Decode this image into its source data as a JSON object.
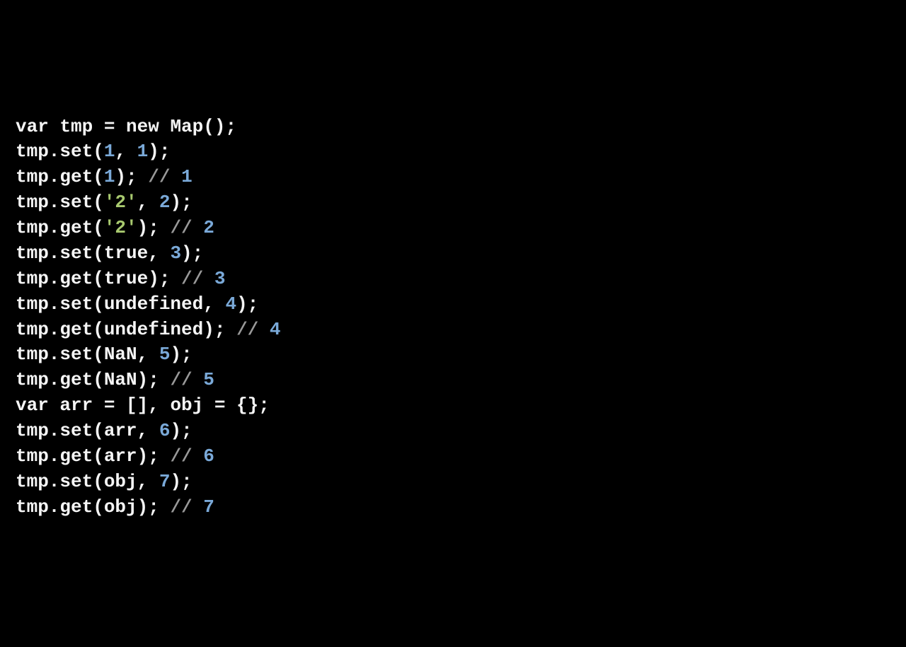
{
  "code": {
    "l1": {
      "t1": "var",
      "t2": " tmp = ",
      "t3": "new",
      "t4": " Map();"
    },
    "l2": {
      "t1": "tmp.set(",
      "n1": "1",
      "t2": ", ",
      "n2": "1",
      "t3": ");"
    },
    "l3": {
      "t1": "tmp.get(",
      "n1": "1",
      "t2": "); ",
      "c1": "// ",
      "cn1": "1"
    },
    "l4": {
      "t1": "tmp.set(",
      "s1": "'2'",
      "t2": ", ",
      "n1": "2",
      "t3": ");"
    },
    "l5": {
      "t1": "tmp.get(",
      "s1": "'2'",
      "t2": "); ",
      "c1": "// ",
      "cn1": "2"
    },
    "l6": {
      "t1": "tmp.set(true, ",
      "n1": "3",
      "t2": ");"
    },
    "l7": {
      "t1": "tmp.get(true); ",
      "c1": "// ",
      "cn1": "3"
    },
    "l8": {
      "t1": "tmp.set(undefined, ",
      "n1": "4",
      "t2": ");"
    },
    "l9": {
      "t1": "tmp.get(undefined); ",
      "c1": "// ",
      "cn1": "4"
    },
    "l10": {
      "t1": "tmp.set(NaN, ",
      "n1": "5",
      "t2": ");"
    },
    "l11": {
      "t1": "tmp.get(NaN); ",
      "c1": "// ",
      "cn1": "5"
    },
    "l12": {
      "t1": "var",
      "t2": " arr = [], obj = {};"
    },
    "l13": {
      "t1": "tmp.set(arr, ",
      "n1": "6",
      "t2": ");"
    },
    "l14": {
      "t1": "tmp.get(arr); ",
      "c1": "// ",
      "cn1": "6"
    },
    "l15": {
      "t1": "tmp.set(obj, ",
      "n1": "7",
      "t2": ");"
    },
    "l16": {
      "t1": "tmp.get(obj); ",
      "c1": "// ",
      "cn1": "7"
    }
  }
}
